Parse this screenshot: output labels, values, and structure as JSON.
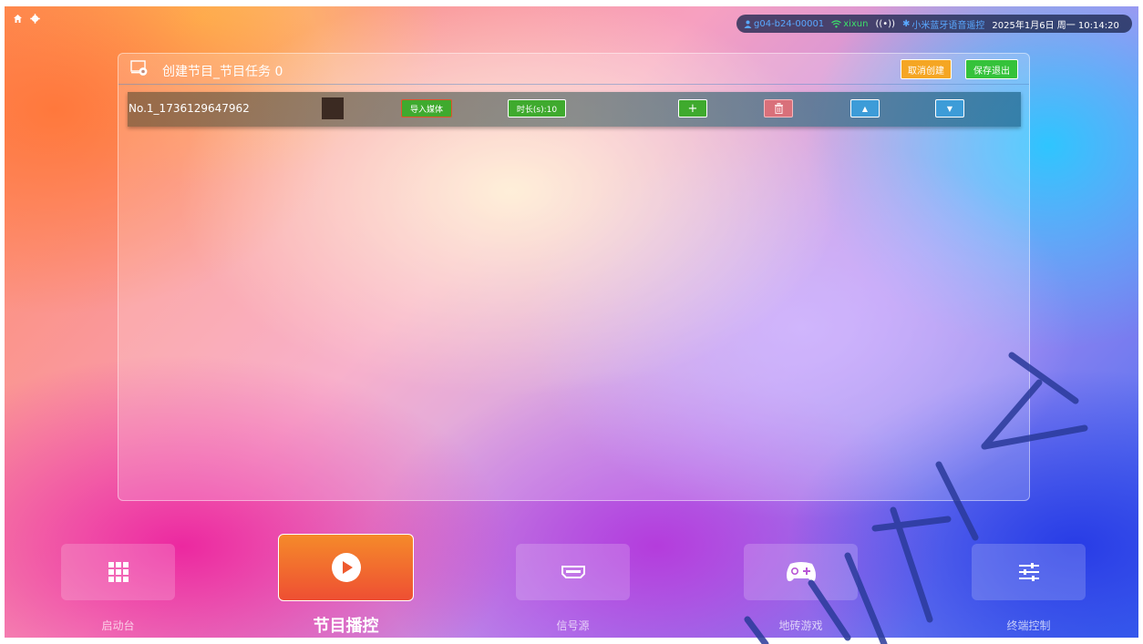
{
  "system": {
    "home_icon": "home-icon",
    "settings_icon": "gear-icon",
    "user_id": "g04-b24-00001",
    "wifi_name": "xixun",
    "bluetooth_device": "小米蓝牙语音遥控",
    "datetime": "2025年1月6日 周一 10:14:20"
  },
  "panel": {
    "title": "创建节目_节目任务 0",
    "cancel_label": "取消创建",
    "save_label": "保存退出"
  },
  "rows": [
    {
      "name": "No.1_1736129647962",
      "import_label": "导入媒体",
      "duration_label": "时长(s):10",
      "add_symbol": "+",
      "delete_symbol": "🗑",
      "up_symbol": "▲",
      "down_symbol": "▼"
    }
  ],
  "nav": [
    {
      "label": "启动台",
      "icon": "grid-icon"
    },
    {
      "label": "节目播控",
      "icon": "play-icon",
      "active": true
    },
    {
      "label": "信号源",
      "icon": "hdmi-icon"
    },
    {
      "label": "地砖游戏",
      "icon": "gamepad-icon"
    },
    {
      "label": "终端控制",
      "icon": "sliders-icon"
    }
  ],
  "colors": {
    "cancel": "#f5a623",
    "save": "#35c23a",
    "active_nav_top": "#f58a2a",
    "active_nav_bottom": "#ee4f33"
  }
}
